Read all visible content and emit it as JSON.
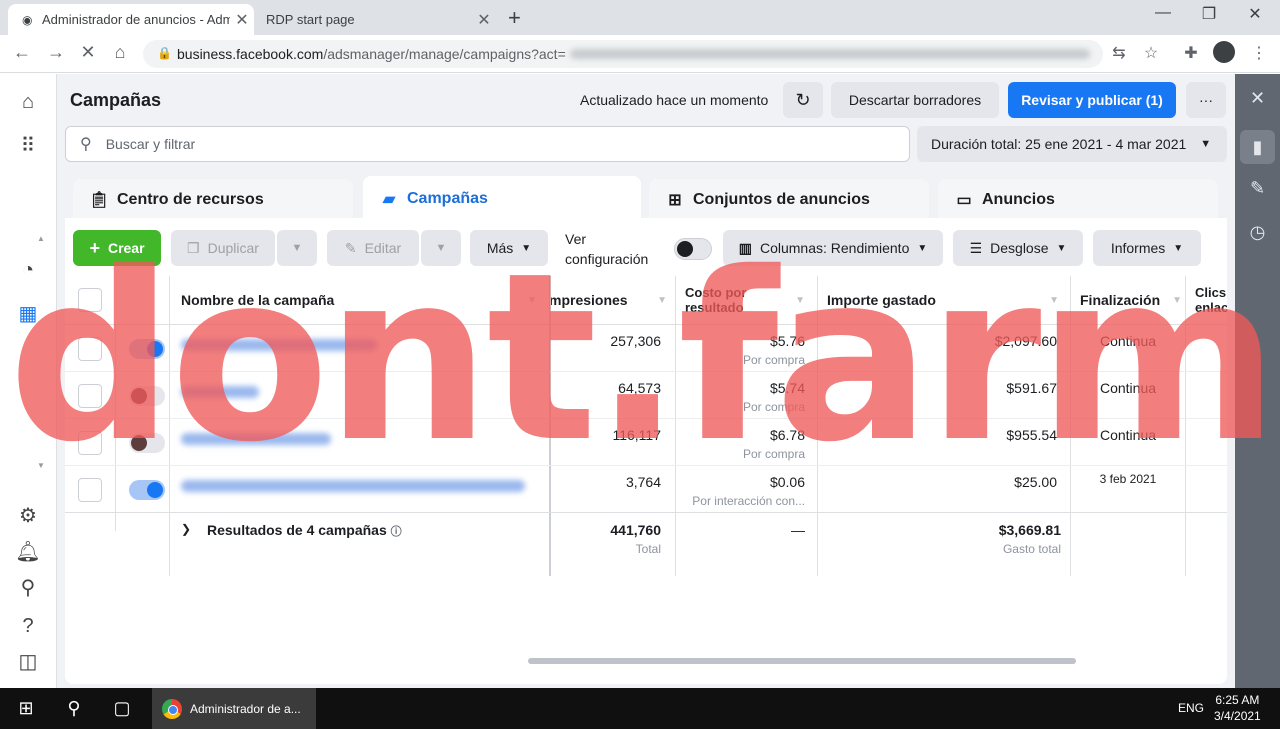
{
  "browser": {
    "tabs": [
      {
        "title": "Administrador de anuncios - Adm",
        "close": "✕"
      },
      {
        "title": "RDP start page",
        "close": "✕"
      }
    ],
    "new_tab": "+",
    "window_controls": [
      "—",
      "❐",
      "✕"
    ],
    "url_domain": "business.facebook.com",
    "url_path": "/adsmanager/manage/campaigns?act="
  },
  "header": {
    "title": "Campañas",
    "updated": "Actualizado hace un momento",
    "discard": "Descartar borradores",
    "publish": "Revisar y publicar (1)",
    "more": "···"
  },
  "search": {
    "placeholder": "Buscar y filtrar"
  },
  "daterange": "Duración total: 25 ene 2021 - 4 mar 2021",
  "level_tabs": [
    {
      "label": "Centro de recursos",
      "icon": "clipboard-icon"
    },
    {
      "label": "Campañas",
      "icon": "folder-icon"
    },
    {
      "label": "Conjuntos de anuncios",
      "icon": "grid-icon"
    },
    {
      "label": "Anuncios",
      "icon": "ad-window-icon"
    }
  ],
  "toolbar": {
    "create": "Crear",
    "duplicate": "Duplicar",
    "edit": "Editar",
    "mas": "Más",
    "ver_config_1": "Ver",
    "ver_config_2": "configuración",
    "columns": "Columnas: Rendimiento",
    "desglose": "Desglose",
    "informes": "Informes"
  },
  "table": {
    "columns": {
      "name": "Nombre de la campaña",
      "impressions": "mpresiones",
      "cost_1": "Costo por",
      "cost_2": "resultado",
      "spent": "Importe gastado",
      "end": "Finalización",
      "clicks_1": "Clics",
      "clicks_2": "enlac"
    },
    "rows": [
      {
        "active": true,
        "impressions": "257,306",
        "cost": "$5.76",
        "cost_sub": "Por compra",
        "spent": "$2,097.60",
        "end": "Continua"
      },
      {
        "active": false,
        "impressions": "64,573",
        "cost": "$5.74",
        "cost_sub": "Por compra",
        "spent": "$591.67",
        "end": "Continua"
      },
      {
        "active": false,
        "impressions": "116,117",
        "cost": "$6.78",
        "cost_sub": "Por compra",
        "spent": "$955.54",
        "end": "Continua"
      },
      {
        "active": true,
        "impressions": "3,764",
        "cost": "$0.06",
        "cost_sub": "Por interacción con...",
        "spent": "$25.00",
        "end": "3 feb 2021"
      }
    ],
    "totals": {
      "label": "Resultados de 4 campañas",
      "impressions": "441,760",
      "impressions_sub": "Total",
      "cost": "—",
      "spent": "$3,669.81",
      "spent_sub": "Gasto total"
    }
  },
  "taskbar": {
    "app": "Administrador de a...",
    "lang": "ENG",
    "time": "6:25 AM",
    "date": "3/4/2021"
  },
  "watermark": "dont.farm",
  "colors": {
    "accent": "#1877f2",
    "create": "#42b72a",
    "watermark": "#f05a5a"
  }
}
